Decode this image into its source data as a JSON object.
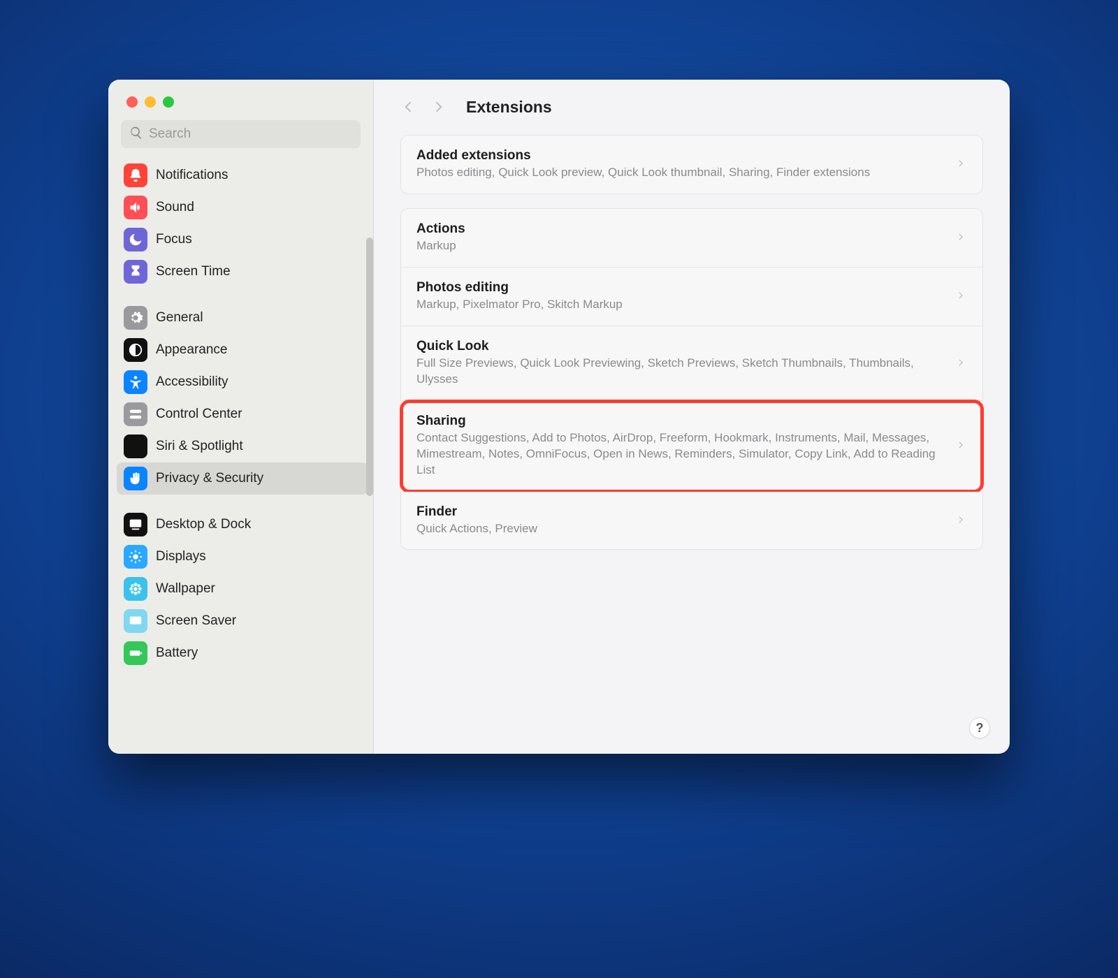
{
  "search": {
    "placeholder": "Search"
  },
  "page_title": "Extensions",
  "sidebar": {
    "groups": [
      [
        {
          "label": "Notifications",
          "icon": "bell",
          "bg": "#ff4338"
        },
        {
          "label": "Sound",
          "icon": "speaker",
          "bg": "#ff4e55"
        },
        {
          "label": "Focus",
          "icon": "moon",
          "bg": "#6e66d6"
        },
        {
          "label": "Screen Time",
          "icon": "hourglass",
          "bg": "#6e66d6"
        }
      ],
      [
        {
          "label": "General",
          "icon": "gear",
          "bg": "#9a9a9d"
        },
        {
          "label": "Appearance",
          "icon": "appearance",
          "bg": "#111"
        },
        {
          "label": "Accessibility",
          "icon": "accessibility",
          "bg": "#0a84ff"
        },
        {
          "label": "Control Center",
          "icon": "switches",
          "bg": "#9a9a9d"
        },
        {
          "label": "Siri & Spotlight",
          "icon": "siri",
          "bg": "#111"
        },
        {
          "label": "Privacy & Security",
          "icon": "hand",
          "bg": "#0a84ff",
          "selected": true
        }
      ],
      [
        {
          "label": "Desktop & Dock",
          "icon": "dock",
          "bg": "#111"
        },
        {
          "label": "Displays",
          "icon": "sun",
          "bg": "#2aa8ff"
        },
        {
          "label": "Wallpaper",
          "icon": "flower",
          "bg": "#39c2ec"
        },
        {
          "label": "Screen Saver",
          "icon": "screensaver",
          "bg": "#7fd8ef"
        },
        {
          "label": "Battery",
          "icon": "battery",
          "bg": "#34c759"
        }
      ]
    ]
  },
  "sections": [
    {
      "rows": [
        {
          "title": "Added extensions",
          "subtitle": "Photos editing, Quick Look preview, Quick Look thumbnail, Sharing, Finder extensions"
        }
      ]
    },
    {
      "rows": [
        {
          "title": "Actions",
          "subtitle": "Markup"
        },
        {
          "title": "Photos editing",
          "subtitle": "Markup, Pixelmator Pro, Skitch Markup"
        },
        {
          "title": "Quick Look",
          "subtitle": "Full Size Previews, Quick Look Previewing, Sketch Previews, Sketch Thumbnails, Thumbnails, Ulysses"
        },
        {
          "title": "Sharing",
          "subtitle": "Contact Suggestions, Add to Photos, AirDrop, Freeform, Hookmark, Instruments, Mail, Messages, Mimestream, Notes, OmniFocus, Open in News, Reminders, Simulator, Copy Link, Add to Reading List",
          "highlighted": true
        },
        {
          "title": "Finder",
          "subtitle": "Quick Actions, Preview"
        }
      ]
    }
  ],
  "help_label": "?"
}
